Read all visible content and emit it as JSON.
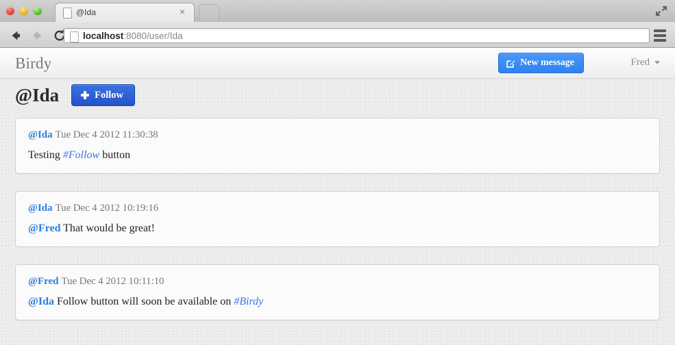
{
  "browser": {
    "tab": {
      "title": "@Ida",
      "close_label": "×"
    },
    "address": {
      "host": "localhost",
      "rest": ":8080/user/Ida"
    },
    "buttons": {
      "back": "back-arrow",
      "forward": "forward-arrow",
      "reload": "reload",
      "menu": "hamburger-menu",
      "fullscreen": "fullscreen",
      "new_tab": "new-tab"
    }
  },
  "navbar": {
    "brand": "Birdy",
    "new_message_label": "New message",
    "user_label": "Fred"
  },
  "profile": {
    "title": "@Ida",
    "follow_label": "Follow"
  },
  "messages": [
    {
      "author": "@Ida",
      "time": "Tue Dec 4 2012 11:30:38",
      "body_pre": "Testing ",
      "body_mention": "",
      "body_tag": "#Follow",
      "body_post": " button"
    },
    {
      "author": "@Ida",
      "time": "Tue Dec 4 2012 10:19:16",
      "body_pre": "",
      "body_mention": "@Fred",
      "body_tag": "",
      "body_post": " That would be great!"
    },
    {
      "author": "@Fred",
      "time": "Tue Dec 4 2012 10:11:10",
      "body_pre": "",
      "body_mention": "@Ida",
      "body_tag": "#Birdy",
      "body_post": " Follow button will soon be available on "
    }
  ],
  "colors": {
    "link_blue": "#2b7fe0",
    "hashtag_blue": "#3a74e8",
    "primary_button": "#2f82ef",
    "follow_button": "#2352ca",
    "page_background": "#ebebeb"
  }
}
